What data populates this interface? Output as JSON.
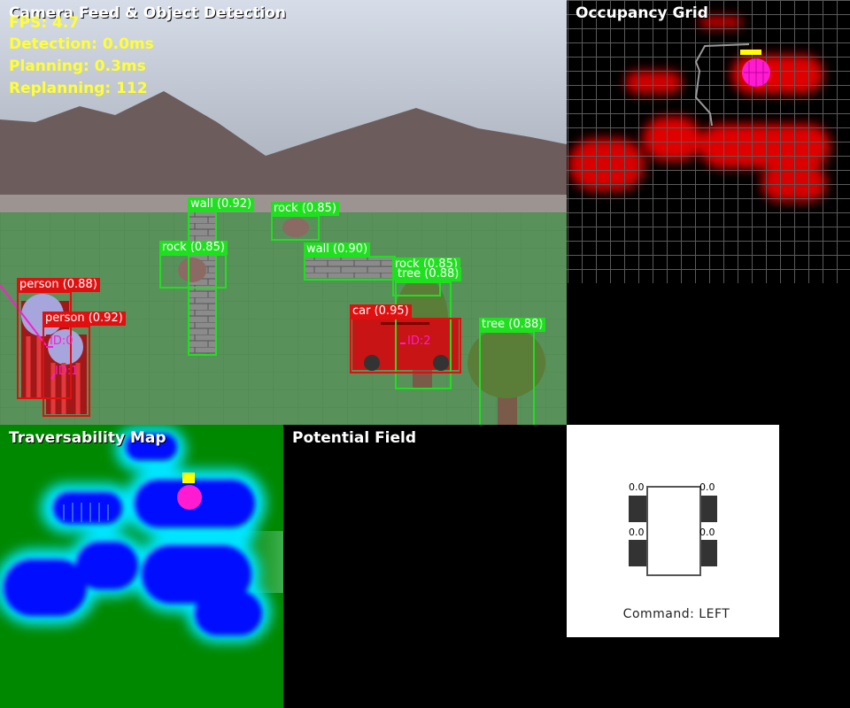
{
  "camera": {
    "title": "Camera Feed & Object Detection",
    "stats": {
      "fps": "FPS: 4.7",
      "detection": "Detection: 0.0ms",
      "planning": "Planning: 0.3ms",
      "replanning": "Replanning: 112"
    },
    "detections": [
      {
        "label": "wall (0.92)"
      },
      {
        "label": "rock (0.85)"
      },
      {
        "label": "rock (0.85)"
      },
      {
        "label": "wall (0.90)"
      },
      {
        "label": "rock (0.85)"
      },
      {
        "label": "tree (0.88)"
      },
      {
        "label": "tree (0.88)"
      },
      {
        "label": "person (0.88)"
      },
      {
        "label": "person (0.92)"
      },
      {
        "label": "car (0.95)"
      }
    ],
    "track_ids": [
      "ID:0",
      "ID:1",
      "ID:2"
    ]
  },
  "occupancy": {
    "title": "Occupancy Grid"
  },
  "traversability": {
    "title": "Traversability Map"
  },
  "potential": {
    "title": "Potential Field"
  },
  "robot": {
    "wheels": [
      "0.0",
      "0.0",
      "0.0",
      "0.0"
    ],
    "command": "Command: LEFT"
  },
  "colors": {
    "detection_green": "#1fe01f",
    "dynamic_red": "#e01010",
    "track_magenta": "#ff1bd0",
    "stats_yellow": "#ffff33"
  }
}
